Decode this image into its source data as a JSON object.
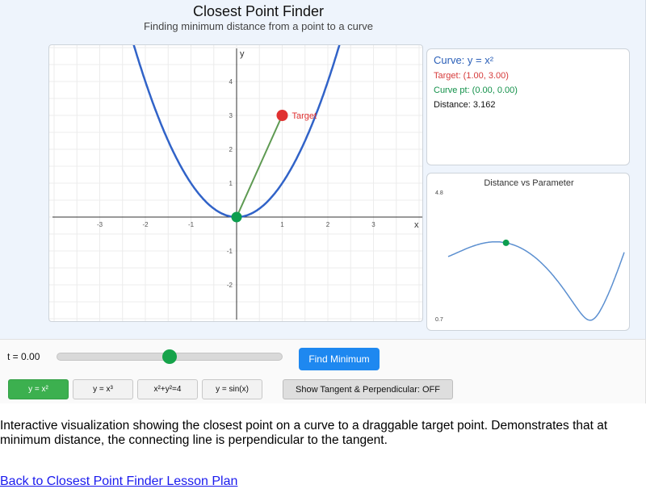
{
  "header": {
    "title": "Closest Point Finder",
    "subtitle": "Finding minimum distance from a point to a curve"
  },
  "graph": {
    "x_axis_label": "x",
    "y_axis_label": "y",
    "x_ticks": [
      "-3",
      "-2",
      "-1",
      "1",
      "2",
      "3"
    ],
    "y_ticks": [
      "4",
      "3",
      "2",
      "1",
      "-1",
      "-2"
    ],
    "target_label": "Target",
    "target_point": [
      1,
      3
    ],
    "curve_point": [
      0,
      0
    ],
    "curve_color": "#3163c8",
    "target_color": "#e03131",
    "curve_point_color": "#0d9e4f",
    "line_color": "#5e9a52"
  },
  "info": {
    "curve": "Curve: y = x²",
    "target": "Target: (1.00, 3.00)",
    "curve_pt": "Curve pt: (0.00, 0.00)",
    "distance": "Distance: 3.162",
    "curve_color": "#2a5fb8",
    "target_color": "#d63b3b",
    "curve_pt_color": "#13914a"
  },
  "mini_chart": {
    "title": "Distance vs Parameter",
    "y_max_label": "4.8",
    "y_min_label": "0.7",
    "line_color": "#5b8fd0",
    "marker_color": "#0d9e4f"
  },
  "controls": {
    "t_label": "t = 0.00",
    "slider_value": 0.5,
    "find_minimum": "Find Minimum",
    "curve_buttons": [
      {
        "label": "y = x²",
        "active": true
      },
      {
        "label": "y = x³",
        "active": false
      },
      {
        "label": "x²+y²=4",
        "active": false
      },
      {
        "label": "y = sin(x)",
        "active": false
      }
    ],
    "tangent_toggle": "Show Tangent & Perpendicular: OFF"
  },
  "description": "Interactive visualization showing the closest point on a curve to a draggable target point. Demonstrates that at minimum distance, the connecting line is perpendicular to the tangent.",
  "back_link": "Back to Closest Point Finder Lesson Plan"
}
